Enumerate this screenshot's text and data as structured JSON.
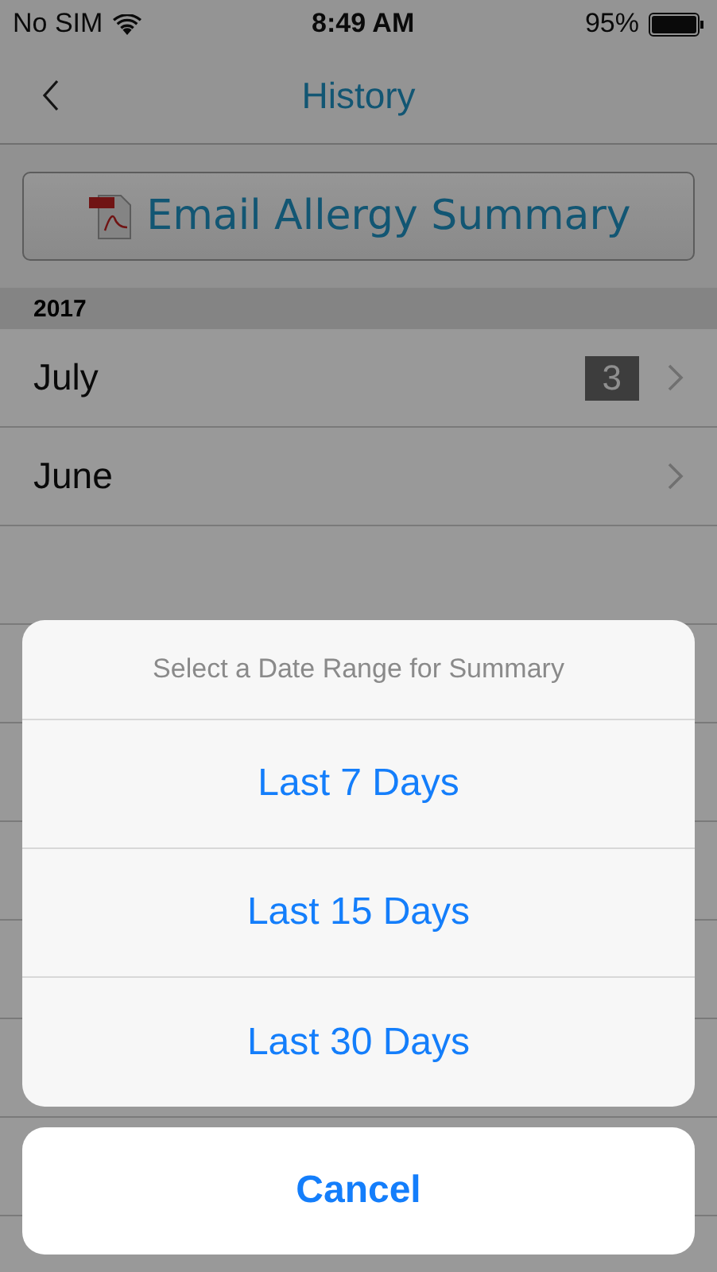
{
  "status_bar": {
    "carrier": "No SIM",
    "time": "8:49 AM",
    "battery": "95%"
  },
  "nav": {
    "title": "History"
  },
  "email_button": {
    "label": "Email Allergy Summary"
  },
  "sections": [
    {
      "header": "2017",
      "rows": [
        {
          "label": "July",
          "count": "3"
        },
        {
          "label": "June"
        }
      ]
    }
  ],
  "action_sheet": {
    "title": "Select a Date Range for Summary",
    "options": [
      "Last 7 Days",
      "Last 15 Days",
      "Last 30 Days"
    ],
    "cancel": "Cancel"
  }
}
